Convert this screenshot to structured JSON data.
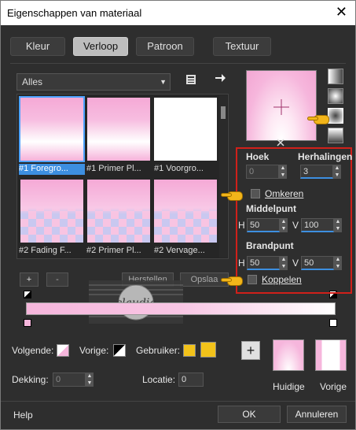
{
  "window": {
    "title": "Eigenschappen van materiaal",
    "close_glyph": "✕"
  },
  "tabs": [
    "Kleur",
    "Verloop",
    "Patroon",
    "Textuur"
  ],
  "active_tab": "Verloop",
  "category_select": {
    "value": "Alles",
    "arrow": "▼"
  },
  "thumbnails": [
    {
      "label": "#1 Foregro...",
      "style": "pink",
      "selected": true
    },
    {
      "label": "#1 Primer Pl...",
      "style": "pink",
      "selected": false
    },
    {
      "label": "#1 Voorgro...",
      "style": "white",
      "selected": false
    },
    {
      "label": "#2 Fading F...",
      "style": "check",
      "selected": false
    },
    {
      "label": "#2 Primer Pl...",
      "style": "check",
      "selected": false
    },
    {
      "label": "#2 Vervage...",
      "style": "check",
      "selected": false
    }
  ],
  "list_buttons": {
    "add": "+",
    "remove": "-",
    "restore": "Herstellen",
    "save": "Opslaa"
  },
  "props": {
    "angle_label": "Hoek",
    "angle_value": "0",
    "repeats_label": "Herhalingen",
    "repeats_value": "3",
    "invert_label": "Omkeren",
    "midpoint_label": "Middelpunt",
    "mid_h_label": "H",
    "mid_h_value": "50",
    "mid_v_label": "V",
    "mid_v_value": "100",
    "focal_label": "Brandpunt",
    "focal_h_label": "H",
    "focal_h_value": "50",
    "focal_v_label": "V",
    "focal_v_value": "50",
    "link_label": "Koppelen"
  },
  "stops_row": {
    "next_label": "Volgende:",
    "prev_label": "Vorige:",
    "user_label": "Gebruiker:",
    "user_color": "#f2c21a"
  },
  "opacity_row": {
    "opacity_label": "Dekking:",
    "opacity_value": "0",
    "location_label": "Locatie:",
    "location_value": "0"
  },
  "current": {
    "current_label": "Huidige",
    "previous_label": "Vorige"
  },
  "footer": {
    "help": "Help",
    "ok": "OK",
    "cancel": "Annuleren"
  },
  "watermark": {
    "text": "claudia"
  },
  "colors": {
    "accent": "#3d8fe0",
    "highlight_box": "#d0201a",
    "pink": "#f6b6dc"
  }
}
